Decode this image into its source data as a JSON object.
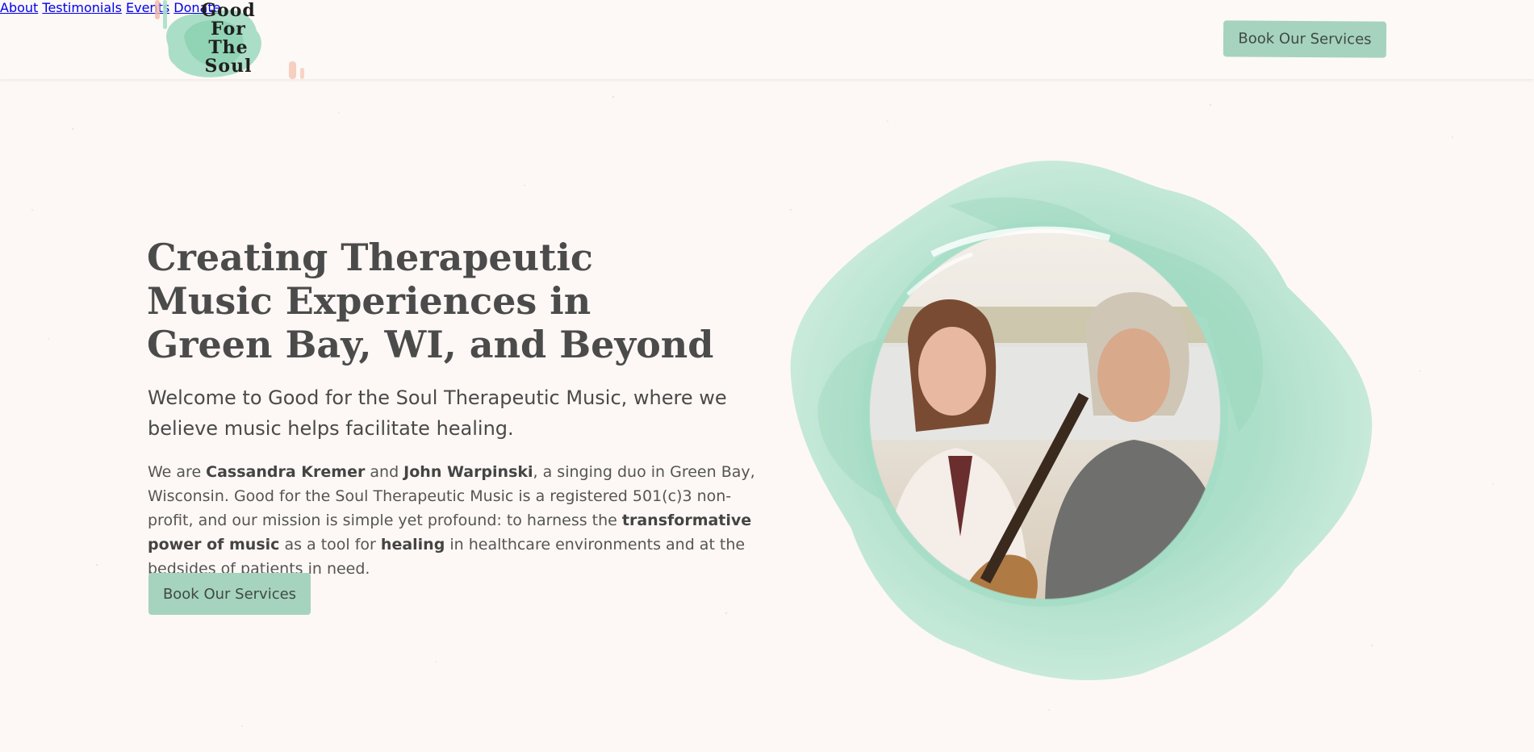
{
  "logo": {
    "line1": "Good",
    "line2": "For",
    "line3": "The",
    "line4": "Soul"
  },
  "nav": {
    "about": "About",
    "testimonials": "Testimonials",
    "events": "Events",
    "donate": "Donate"
  },
  "header_cta": "Book Our Services",
  "hero": {
    "title": "Creating Therapeutic Music Experiences in Green Bay, WI, and Beyond",
    "subtitle": "Welcome to Good for the Soul Therapeutic Music, where we believe music helps facilitate healing.",
    "body": {
      "t1": "We are ",
      "b1": "Cassandra Kremer",
      "t2": " and ",
      "b2": "John Warpinski",
      "t3": ", a singing duo in Green Bay, Wisconsin. Good for the Soul Therapeutic Music is a registered 501(c)3 non-profit, and our mission is simple yet profound: to harness the ",
      "b3": "transformative power of music",
      "t4": " as a tool for ",
      "b4": "healing",
      "t5": " in healthcare environments and at the bedsides of patients in need."
    },
    "cta": "Book Our Services"
  },
  "colors": {
    "background": "#fdf8f5",
    "accent_green": "#a6d3bd",
    "text": "#4a4a4a"
  }
}
